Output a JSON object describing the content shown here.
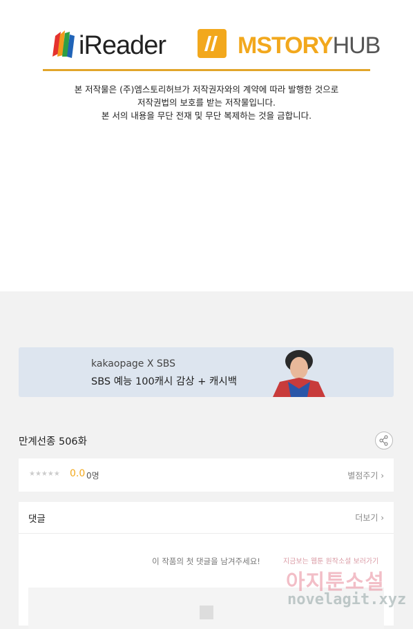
{
  "header": {
    "logo_left": "iReader",
    "logo_right_main": "MSTORY",
    "logo_right_suffix": "HUB",
    "notice_lines": [
      "본 저작물은 (주)엠스토리허브가 저작권자와의 계약에 따라 발행한 것으로",
      "저작권법의 보호를 받는 저작물입니다.",
      "본 서의 내용을 무단 전재 및 무단 복제하는 것을 금합니다."
    ],
    "colors": {
      "accent": "#e2a52a",
      "ms_orange": "#f2a81d"
    }
  },
  "banner": {
    "subtitle": "kakaopage X SBS",
    "title": "SBS 예능 100캐시 감상 + 캐시백"
  },
  "episode": {
    "title": "만계선종 506화"
  },
  "rating": {
    "stars": "★★★★★",
    "score": "0.0",
    "count": "0명",
    "rate_link": "별점주기 ›"
  },
  "comments": {
    "title": "댓글",
    "more_link": "더보기 ›",
    "empty_message": "이 작품의 첫 댓글을 남겨주세요!"
  },
  "watermark": {
    "line1": "지금보는 웹툰 원작소설 보러가기",
    "line2": "아지툰소설",
    "line3": "novelagit.xyz"
  },
  "icons": {
    "share": "share-icon",
    "ireader": "ireader-book-icon",
    "mstory": "mstory-hub-icon",
    "input": "image-placeholder-icon"
  }
}
